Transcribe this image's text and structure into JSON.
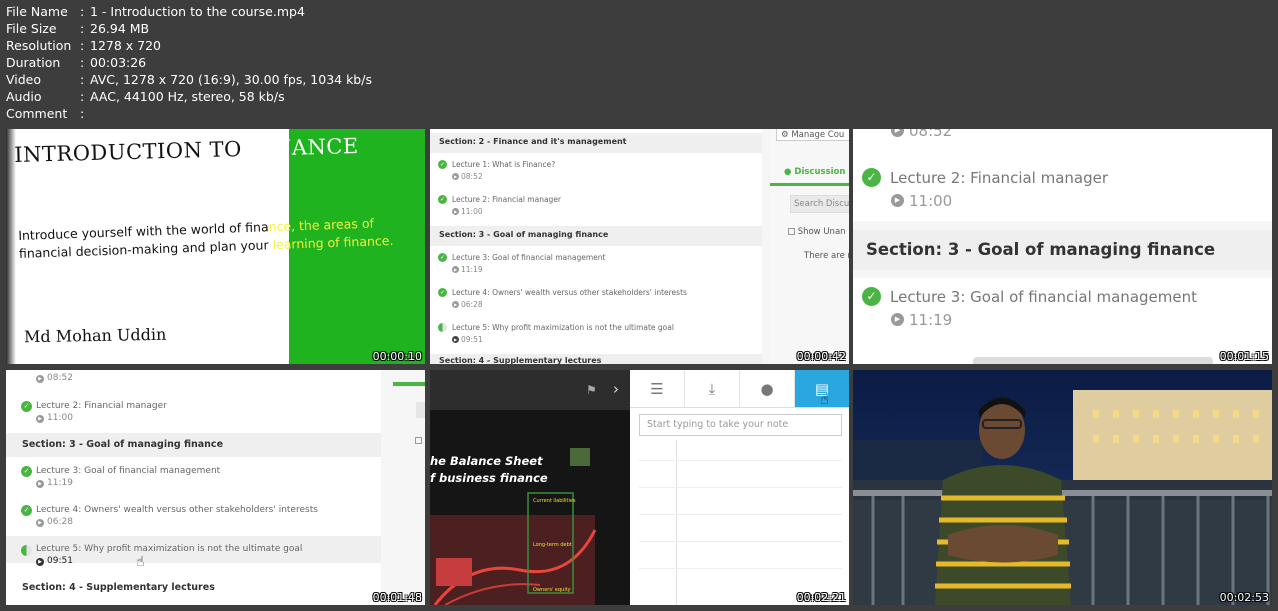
{
  "meta": [
    {
      "key": "File Name",
      "value": "1 - Introduction to the course.mp4"
    },
    {
      "key": "File Size",
      "value": "26.94 MB"
    },
    {
      "key": "Resolution",
      "value": "1278 x 720"
    },
    {
      "key": "Duration",
      "value": "00:03:26"
    },
    {
      "key": "Video",
      "value": "AVC, 1278 x 720 (16:9), 30.00 fps, 1034 kb/s"
    },
    {
      "key": "Audio",
      "value": "AAC, 44100 Hz, stereo, 58 kb/s"
    },
    {
      "key": "Comment",
      "value": ""
    }
  ],
  "thumbs": [
    {
      "timestamp": "00:00:10",
      "title_a": "INTRODUCTION TO",
      "title_b": "FINANCE",
      "sub1a": "Introduce yourself with the world  of  fina",
      "sub1b": "nce, the areas of",
      "sub2a": "financial decision-making and plan  your",
      "sub2b": "learning of finance.",
      "author": "Md Mohan Uddin"
    },
    {
      "timestamp": "00:00:42",
      "section2": "Section: 2 - Finance and it's management",
      "lec1": "Lecture 1: What is Finance?",
      "lec1_dur": "08:52",
      "lec2": "Lecture 2: Financial manager",
      "lec2_dur": "11:00",
      "section3": "Section: 3 - Goal of managing finance",
      "lec3": "Lecture 3: Goal of financial management",
      "lec3_dur": "11:19",
      "lec4": "Lecture 4: Owners' wealth versus other stakeholders' interests",
      "lec4_dur": "06:28",
      "lec5": "Lecture 5: Why profit maximization is not the ultimate goal",
      "lec5_dur": "09:51",
      "section4": "Section: 4 - Supplementary lectures",
      "manage": "Manage Cou",
      "discussions": "Discussion",
      "search": "Search Discu",
      "show_unanswered": "Show Unan",
      "there_are": "There are r"
    },
    {
      "timestamp": "00:01:15",
      "lec1_dur": "08:52",
      "lec2": "Lecture 2: Financial manager",
      "lec2_dur": "11:00",
      "section3": "Section: 3 - Goal of managing finance",
      "lec3": "Lecture 3: Goal of financial management",
      "lec3_dur": "11:19"
    },
    {
      "timestamp": "00:01:48",
      "lec1_dur": "08:52",
      "lec2": "Lecture 2: Financial manager",
      "lec2_dur": "11:00",
      "section3": "Section: 3 - Goal of managing finance",
      "lec3": "Lecture 3: Goal of financial management",
      "lec3_dur": "11:19",
      "lec4": "Lecture 4: Owners' wealth versus other stakeholders' interests",
      "lec4_dur": "06:28",
      "lec5": "Lecture 5: Why profit maximization is not the ultimate goal",
      "lec5_dur": "09:51",
      "section4": "Section: 4 - Supplementary lectures"
    },
    {
      "timestamp": "00:02:21",
      "video_title1": "he Balance Sheet",
      "video_title2": "f business finance",
      "box1": "Current liabilities",
      "box2": "Long-term debt",
      "box3": "Owners' equity",
      "note_placeholder": "Start typing to take your note"
    },
    {
      "timestamp": "00:02:53"
    }
  ],
  "colors": {
    "background": "#3d3d3d",
    "green_block": "#1fb31f",
    "check_green": "#4bb543",
    "active_tab": "#29a8e0"
  }
}
